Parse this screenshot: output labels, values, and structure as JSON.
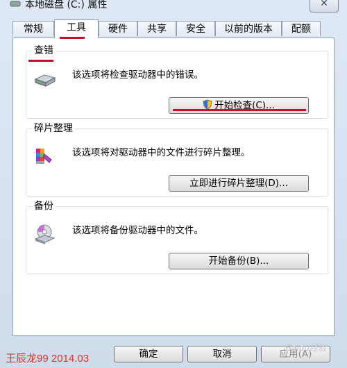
{
  "window": {
    "title": "本地磁盘 (C:) 属性",
    "close_glyph": "✕"
  },
  "tabs": [
    {
      "label": "常规",
      "active": false
    },
    {
      "label": "工具",
      "active": true
    },
    {
      "label": "硬件",
      "active": false
    },
    {
      "label": "共享",
      "active": false
    },
    {
      "label": "安全",
      "active": false
    },
    {
      "label": "以前的版本",
      "active": false
    },
    {
      "label": "配额",
      "active": false
    }
  ],
  "groups": {
    "error_check": {
      "title": "查错",
      "description": "该选项将检查驱动器中的错误。",
      "button": "开始检查(C)...",
      "icon": "hard-drive-icon"
    },
    "defrag": {
      "title": "碎片整理",
      "description": "该选项将对驱动器中的文件进行碎片整理。",
      "button": "立即进行碎片整理(D)...",
      "icon": "defrag-icon"
    },
    "backup": {
      "title": "备份",
      "description": "该选项将备份驱动器中的文件。",
      "button": "开始备份(B)...",
      "icon": "backup-icon"
    }
  },
  "footer": {
    "ok": "确定",
    "cancel": "取消",
    "apply": "应用(A)"
  },
  "watermark": {
    "left": "王辰龙99 2014.03",
    "right": "Baidu经验"
  },
  "colors": {
    "annotation_red": "#c8102e",
    "window_blue": "#dfe9f5"
  }
}
